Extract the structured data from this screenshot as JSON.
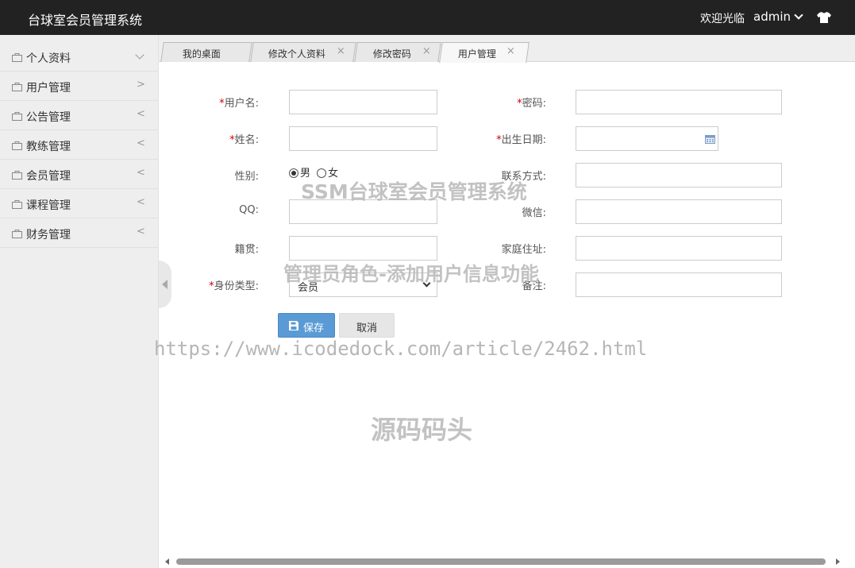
{
  "header": {
    "title": "台球室会员管理系统",
    "welcome": "欢迎光临",
    "username": "admin",
    "theme_icon": "shirt-icon"
  },
  "sidebar": {
    "items": [
      {
        "label": "个人资料",
        "arrow": "v",
        "icon": "bag-icon"
      },
      {
        "label": "用户管理",
        "arrow": ">",
        "icon": "bag-icon"
      },
      {
        "label": "公告管理",
        "arrow": "<",
        "icon": "bag-icon"
      },
      {
        "label": "教练管理",
        "arrow": "<",
        "icon": "bag-icon"
      },
      {
        "label": "会员管理",
        "arrow": "<",
        "icon": "bag-icon"
      },
      {
        "label": "课程管理",
        "arrow": "<",
        "icon": "bag-icon"
      },
      {
        "label": "财务管理",
        "arrow": "<",
        "icon": "bag-icon"
      }
    ]
  },
  "tabs": [
    {
      "label": "我的桌面",
      "closable": false
    },
    {
      "label": "修改个人资料",
      "closable": true,
      "close": "×"
    },
    {
      "label": "修改密码",
      "closable": true,
      "close": "×"
    },
    {
      "label": "用户管理",
      "closable": true,
      "close": "×",
      "active": true
    }
  ],
  "form": {
    "required_mark": "*",
    "username_label": "用户名:",
    "username_value": "",
    "password_label": "密码:",
    "password_value": "",
    "name_label": "姓名:",
    "name_value": "",
    "birthday_label": "出生日期:",
    "birthday_value": "",
    "gender_label": "性别:",
    "gender_options": [
      "男",
      "女"
    ],
    "gender_selected": "男",
    "contact_label": "联系方式:",
    "contact_value": "",
    "qq_label": "QQ:",
    "qq_value": "",
    "wechat_label": "微信:",
    "wechat_value": "",
    "origin_label": "籍贯:",
    "origin_value": "",
    "address_label": "家庭住址:",
    "address_value": "",
    "role_label": "身份类型:",
    "role_selected": "会员",
    "remark_label": "备注:",
    "remark_value": "",
    "save_label": "保存",
    "cancel_label": "取消"
  },
  "watermarks": {
    "line1": "SSM台球室会员管理系统",
    "line2": "管理员角色-添加用户信息功能",
    "line3": "https://www.icodedock.com/article/2462.html",
    "line4": "源码码头"
  }
}
